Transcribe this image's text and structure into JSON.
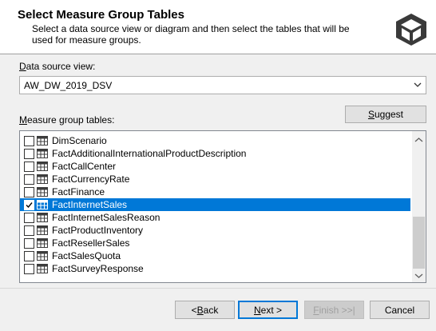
{
  "header": {
    "title": "Select Measure Group Tables",
    "description": "Select a data source view or diagram and then select the tables that will be used for measure groups."
  },
  "data_source": {
    "label_accel": "D",
    "label_rest": "ata source view:",
    "value": "AW_DW_2019_DSV"
  },
  "suggest_button": {
    "accel": "S",
    "rest": "uggest"
  },
  "tables": {
    "label_accel": "M",
    "label_rest": "easure group tables:",
    "items": [
      {
        "name": "DimScenario",
        "checked": false,
        "selected": false
      },
      {
        "name": "FactAdditionalInternationalProductDescription",
        "checked": false,
        "selected": false
      },
      {
        "name": "FactCallCenter",
        "checked": false,
        "selected": false
      },
      {
        "name": "FactCurrencyRate",
        "checked": false,
        "selected": false
      },
      {
        "name": "FactFinance",
        "checked": false,
        "selected": false
      },
      {
        "name": "FactInternetSales",
        "checked": true,
        "selected": true
      },
      {
        "name": "FactInternetSalesReason",
        "checked": false,
        "selected": false
      },
      {
        "name": "FactProductInventory",
        "checked": false,
        "selected": false
      },
      {
        "name": "FactResellerSales",
        "checked": false,
        "selected": false
      },
      {
        "name": "FactSalesQuota",
        "checked": false,
        "selected": false
      },
      {
        "name": "FactSurveyResponse",
        "checked": false,
        "selected": false
      }
    ]
  },
  "buttons": {
    "back": {
      "pre": "< ",
      "accel": "B",
      "rest": "ack"
    },
    "next": {
      "pre": "",
      "accel": "N",
      "rest": "ext >"
    },
    "finish": {
      "pre": "",
      "accel": "F",
      "rest": "inish >>|"
    },
    "cancel": "Cancel"
  },
  "colors": {
    "selection": "#0078d7",
    "accent_border": "#0078d7"
  },
  "icons": {
    "logo": "cube-logo-icon",
    "dropdown": "chevron-down-icon",
    "table": "table-icon",
    "check": "checkmark-icon"
  }
}
